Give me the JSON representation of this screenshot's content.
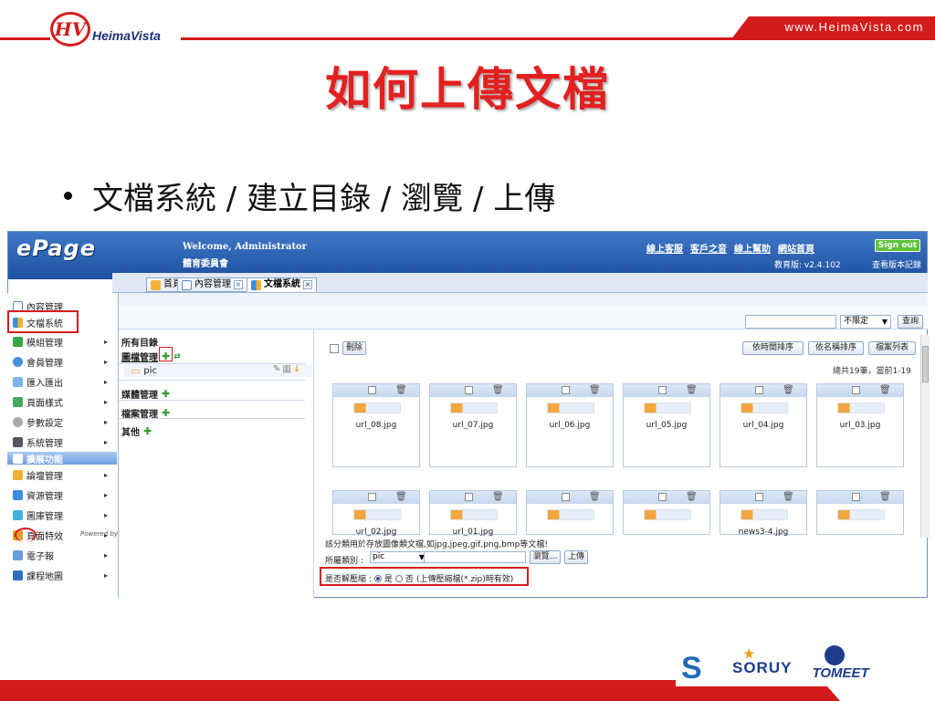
{
  "slide": {
    "brand": "HeimaVista",
    "url": "www.HeimaVista.com",
    "title": "如何上傳文檔",
    "bullet": "文檔系統 / 建立目錄 / 瀏覽 / 上傳",
    "footer_logos": [
      "SORUY",
      "TOMEET"
    ]
  },
  "app": {
    "logo": "ePage",
    "welcome": "Welcome, Administrator",
    "org": "體育委員會",
    "top_links": [
      "線上客服",
      "客戶之音",
      "線上幫助",
      "網站首頁"
    ],
    "signout": "Sign out",
    "version": "教育版: v2.4.102",
    "version_log": "查看版本記錄",
    "tabs": [
      {
        "label": "首頁",
        "closable": false
      },
      {
        "label": "內容管理",
        "closable": true
      },
      {
        "label": "文檔系統",
        "closable": true,
        "active": true
      }
    ],
    "sidebar": [
      {
        "label": "內容管理",
        "icon": "page-icon",
        "arrow": false
      },
      {
        "label": "文檔系統",
        "icon": "doc-system-icon",
        "arrow": false,
        "boxed": true
      },
      {
        "label": "模組管理",
        "icon": "module-icon",
        "arrow": true
      },
      {
        "label": "會員管理",
        "icon": "members-icon",
        "arrow": true
      },
      {
        "label": "匯入匯出",
        "icon": "import-export-icon",
        "arrow": true
      },
      {
        "label": "頁面樣式",
        "icon": "style-icon",
        "arrow": true
      },
      {
        "label": "參數設定",
        "icon": "settings-icon",
        "arrow": true
      },
      {
        "label": "系統管理",
        "icon": "system-icon",
        "arrow": true
      },
      {
        "label": "擴展功能",
        "icon": "extend-icon",
        "arrow": false,
        "highlight": true
      },
      {
        "label": "論壇管理",
        "icon": "forum-icon",
        "arrow": true
      },
      {
        "label": "資源管理",
        "icon": "resource-icon",
        "arrow": true
      },
      {
        "label": "圖庫管理",
        "icon": "gallery-icon",
        "arrow": true
      },
      {
        "label": "頁面特效",
        "icon": "effects-icon",
        "arrow": true
      },
      {
        "label": "電子報",
        "icon": "newsletter-icon",
        "arrow": true
      },
      {
        "label": "課程地圖",
        "icon": "course-map-icon",
        "arrow": true
      }
    ],
    "powered_by": "Powered by",
    "search": {
      "placeholder": "",
      "filter": "不限定",
      "button": "查詢"
    },
    "tree": {
      "root": "所有目錄",
      "groups": [
        {
          "label": "圖檔管理",
          "children": [
            "pic"
          ]
        },
        {
          "label": "媒體管理",
          "children": []
        },
        {
          "label": "檔案管理",
          "children": []
        },
        {
          "label": "其他",
          "children": []
        }
      ]
    },
    "toolbar": {
      "delete": "刪除",
      "sort_time": "依時間排序",
      "sort_name": "依名稱排序",
      "list": "檔案列表",
      "count": "總共19筆，當前1-19"
    },
    "files_row1": [
      "url_08.jpg",
      "url_07.jpg",
      "url_06.jpg",
      "url_05.jpg",
      "url_04.jpg",
      "url_03.jpg"
    ],
    "files_row2": [
      "url_02.jpg",
      "url_01.jpg",
      "",
      "",
      "news3-4.jpg",
      ""
    ],
    "upload": {
      "desc": "該分類用於存放圖像類文檔,如jpg,jpeg,gif,png,bmp等文檔!",
      "category_label": "所屬類別 :",
      "category_value": "pic",
      "browse": "瀏覽...",
      "upload": "上傳",
      "unzip_label": "是否解壓縮 :",
      "yes": "是",
      "no": "否",
      "note": "(上傳壓縮檔(*.zip)時有效)"
    },
    "colors": {
      "header": "#1d4f9f",
      "accent": "#d41b1b",
      "plus": "#2f9d2f"
    }
  }
}
